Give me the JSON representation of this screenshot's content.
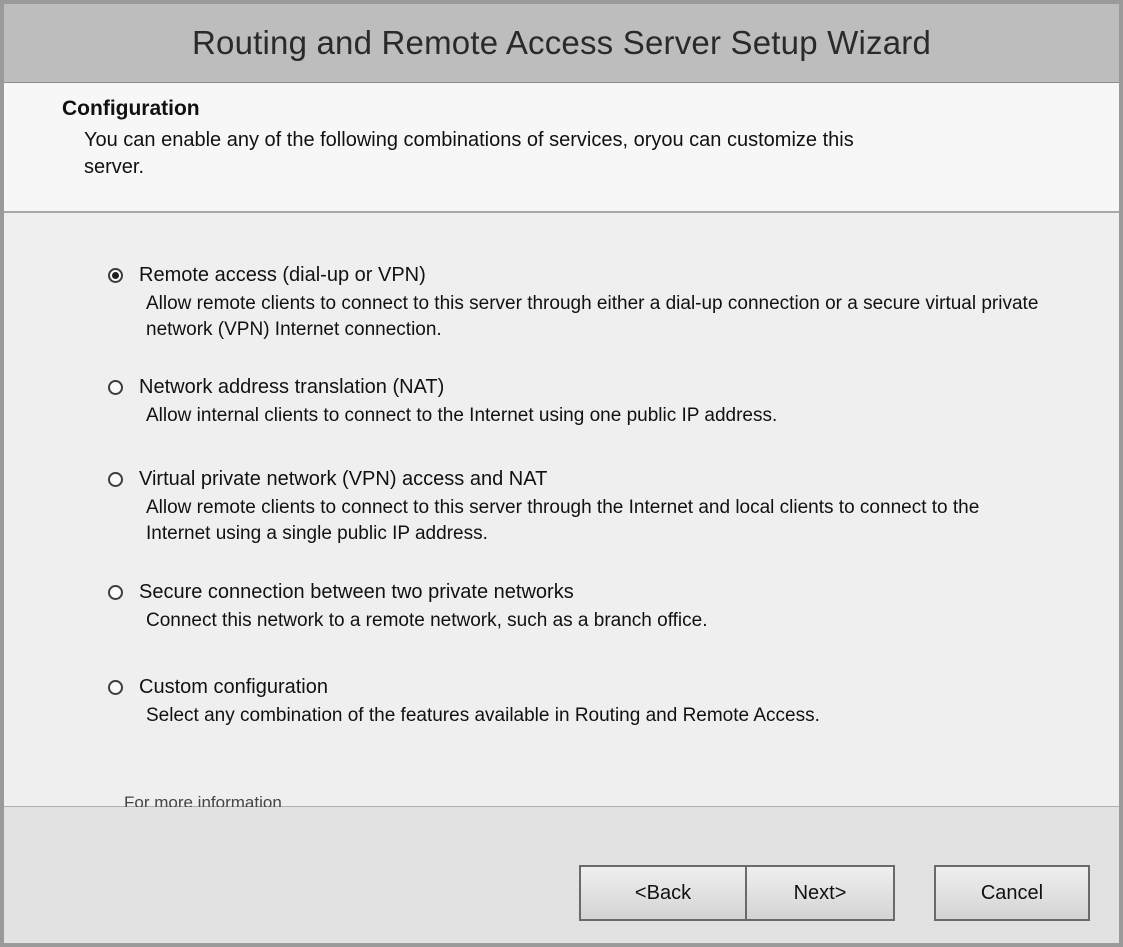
{
  "window": {
    "title": "Routing and Remote Access Server Setup Wizard"
  },
  "header": {
    "heading": "Configuration",
    "description": "You can enable any of the following combinations of services, oryou can customize this server."
  },
  "options": [
    {
      "label": "Remote access (dial-up or VPN)",
      "description": "Allow remote clients to connect to this server through either a dial-up connection or a secure virtual private network (VPN) Internet connection.",
      "selected": true
    },
    {
      "label": "Network address translation (NAT)",
      "description": "Allow internal clients to connect to the Internet using one public IP address.",
      "selected": false
    },
    {
      "label": "Virtual private network (VPN) access and NAT",
      "description": "Allow remote clients to connect to this server through the Internet and local clients to connect to the Internet using a single public IP address.",
      "selected": false
    },
    {
      "label": "Secure connection between two private networks",
      "description": "Connect this network to a remote network, such as a branch office.",
      "selected": false
    },
    {
      "label": "Custom configuration",
      "description": "Select any combination of the features available in Routing and Remote Access.",
      "selected": false
    }
  ],
  "more_info_link": "For more information",
  "buttons": {
    "back": "<Back",
    "next": "Next>",
    "cancel": "Cancel"
  }
}
